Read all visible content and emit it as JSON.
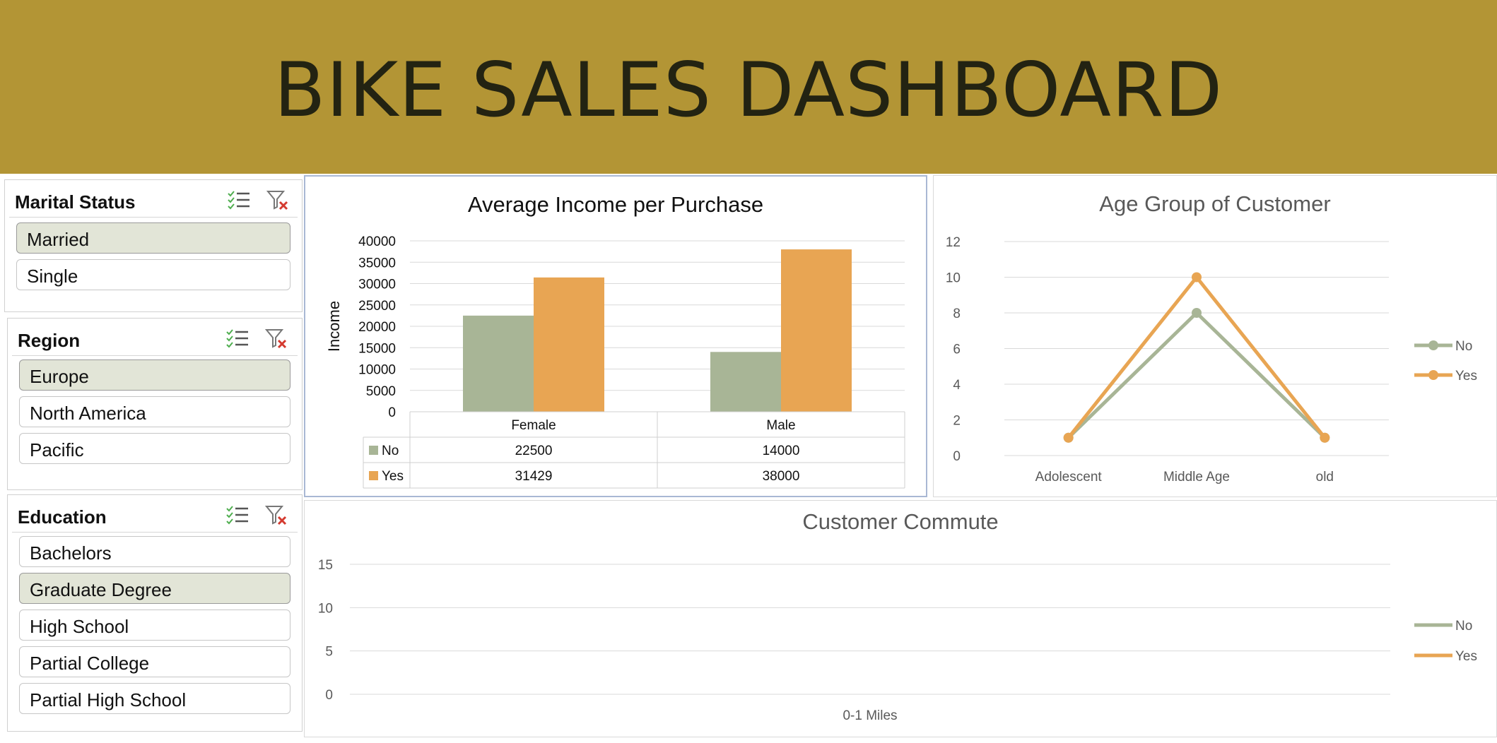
{
  "header": {
    "title": "BIKE SALES DASHBOARD"
  },
  "slicers": [
    {
      "title": "Marital Status",
      "items": [
        {
          "label": "Married",
          "selected": true
        },
        {
          "label": "Single",
          "selected": false
        }
      ]
    },
    {
      "title": "Region",
      "items": [
        {
          "label": "Europe",
          "selected": true
        },
        {
          "label": "North America",
          "selected": false
        },
        {
          "label": "Pacific",
          "selected": false
        }
      ]
    },
    {
      "title": "Education",
      "items": [
        {
          "label": "Bachelors",
          "selected": false
        },
        {
          "label": "Graduate Degree",
          "selected": true
        },
        {
          "label": "High School",
          "selected": false
        },
        {
          "label": "Partial College",
          "selected": false
        },
        {
          "label": "Partial High School",
          "selected": false
        }
      ]
    }
  ],
  "icons": {
    "multi_select": "multi-select-icon",
    "clear_filter": "clear-filter-icon"
  },
  "colors": {
    "banner": "#b39535",
    "no": "#a8b596",
    "yes": "#e8a553",
    "selected_item": "#e2e5d7"
  },
  "chart_data": [
    {
      "type": "bar",
      "title": "Average Income per Purchase",
      "ylabel": "Income",
      "categories": [
        "Female",
        "Male"
      ],
      "series": [
        {
          "name": "No",
          "values": [
            22500,
            14000
          ]
        },
        {
          "name": "Yes",
          "values": [
            31429,
            38000
          ]
        }
      ],
      "ylim": [
        0,
        40000
      ],
      "yticks": [
        0,
        5000,
        10000,
        15000,
        20000,
        25000,
        30000,
        35000,
        40000
      ],
      "data_table": true,
      "grid": true
    },
    {
      "type": "line",
      "title": "Age Group of Customer",
      "categories": [
        "Adolescent",
        "Middle Age",
        "old"
      ],
      "series": [
        {
          "name": "No",
          "values": [
            1,
            8,
            1
          ]
        },
        {
          "name": "Yes",
          "values": [
            1,
            10,
            1
          ]
        }
      ],
      "ylim": [
        0,
        12
      ],
      "yticks": [
        0,
        2,
        4,
        6,
        8,
        10,
        12
      ],
      "legend": "right",
      "grid": true
    },
    {
      "type": "line",
      "title": "Customer Commute",
      "categories": [
        "0-1 Miles"
      ],
      "series": [
        {
          "name": "No",
          "values": []
        },
        {
          "name": "Yes",
          "values": []
        }
      ],
      "ylim": [
        0,
        15
      ],
      "yticks": [
        0,
        5,
        10,
        15
      ],
      "legend": "right",
      "grid": true
    }
  ]
}
